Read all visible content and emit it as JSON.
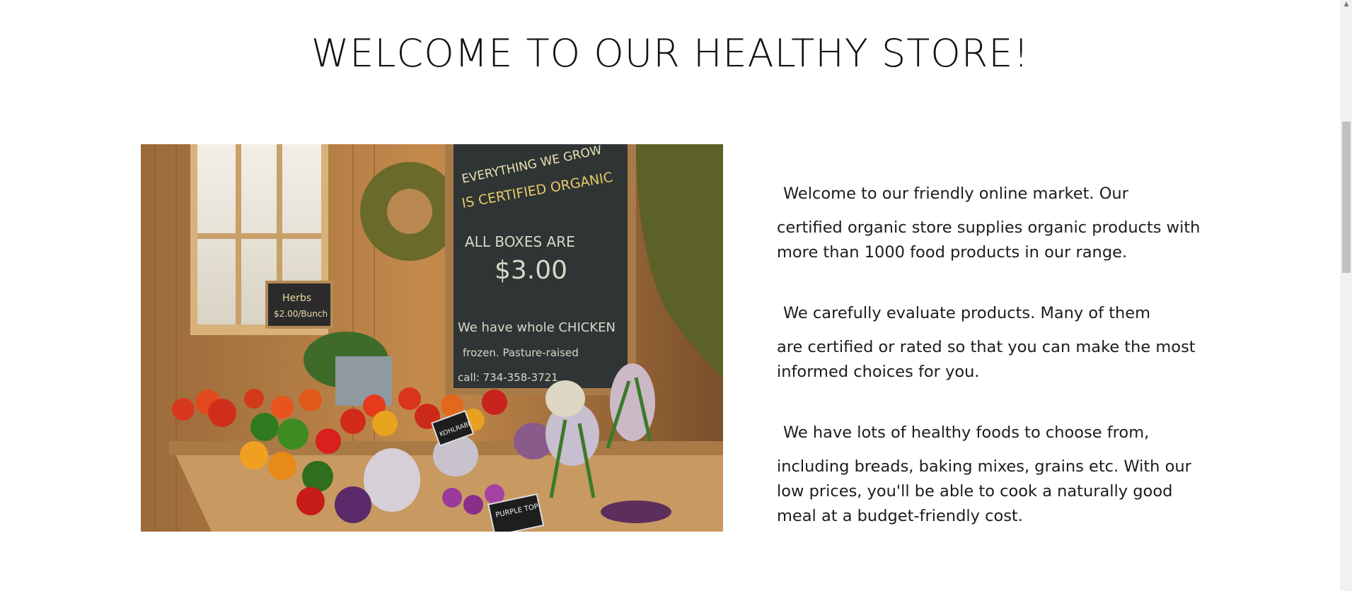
{
  "heading": "WELCOME TO OUR HEALTHY STORE!",
  "image": {
    "chalkboard_lines": [
      "EVERYTHING WE GROW",
      "IS CERTIFIED ORGANIC",
      "ALL BOXES ARE",
      "$3.00",
      "We have whole CHICKEN",
      "frozen. Pasture-raised",
      "call: 734-358-3721"
    ],
    "small_sign": [
      "Herbs",
      "$2.00/Bunch"
    ],
    "tags": [
      "KOHLRABI",
      "PURPLE TOP"
    ]
  },
  "paragraphs": [
    {
      "first": "Welcome to our friendly online market. Our",
      "rest": "certified organic store supplies organic products with more than 1000 food products in our range."
    },
    {
      "first": "We carefully evaluate products. Many of them",
      "rest": "are certified or rated so that you can make the most informed choices for you."
    },
    {
      "first": "We have lots of healthy foods to choose from,",
      "rest": "including breads, baking mixes, grains etc. With our low prices, you'll be able to cook a naturally good meal at a budget-friendly cost."
    }
  ],
  "scrollbar": {
    "up_arrow": "▲"
  }
}
